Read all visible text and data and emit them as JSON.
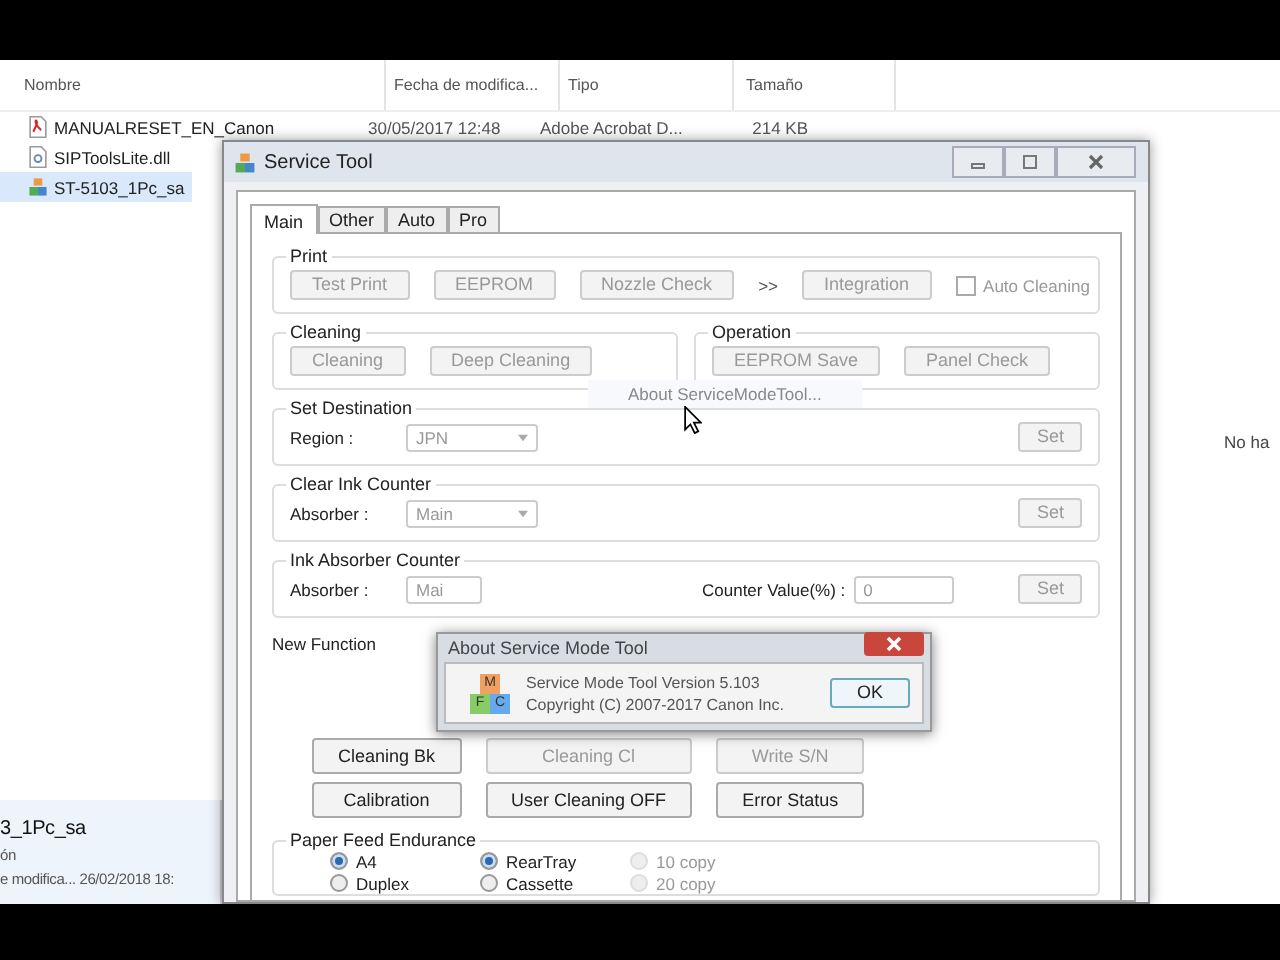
{
  "explorer": {
    "columns": [
      "Nombre",
      "Fecha de modifica...",
      "Tipo",
      "Tamaño"
    ],
    "rows": [
      {
        "name": "MANUALRESET_EN_Canon",
        "kind": "pdf",
        "date": "30/05/2017 12:48",
        "type": "Adobe Acrobat D...",
        "size": "214 KB",
        "selected": false
      },
      {
        "name": "SIPToolsLite.dll",
        "kind": "dll",
        "selected": false
      },
      {
        "name": "ST-5103_1Pc_sa",
        "kind": "app",
        "selected": true
      }
    ],
    "preview_text": "No ha",
    "details": {
      "name": "3_1Pc_sa",
      "line_2": "ón",
      "date_label": "e modifica...",
      "date": "26/02/2018 18:"
    }
  },
  "window": {
    "title": "Service Tool",
    "tabs": [
      {
        "label": "Main",
        "selected": true
      },
      {
        "label": "Other",
        "selected": false
      },
      {
        "label": "Auto",
        "selected": false
      },
      {
        "label": "Pro",
        "selected": false
      }
    ],
    "print": {
      "title": "Print",
      "buttons": [
        {
          "label": "Test Print",
          "disabled": true
        },
        {
          "label": "EEPROM",
          "disabled": true
        },
        {
          "label": "Nozzle Check",
          "disabled": true
        }
      ],
      "arrow": ">>",
      "integration": {
        "label": "Integration",
        "disabled": true
      },
      "auto_cleaning": {
        "label": "Auto Cleaning",
        "checked": false
      }
    },
    "cleaning": {
      "title": "Cleaning",
      "buttons": [
        {
          "label": "Cleaning",
          "disabled": true
        },
        {
          "label": "Deep Cleaning",
          "disabled": true
        }
      ]
    },
    "operation": {
      "title": "Operation",
      "buttons": [
        {
          "label": "EEPROM Save",
          "disabled": true
        },
        {
          "label": "Panel Check",
          "disabled": true
        }
      ]
    },
    "ghost_menu_item": "About ServiceModeTool...",
    "set_destination": {
      "title": "Set Destination",
      "label": "Region :",
      "value": "JPN",
      "button": "Set"
    },
    "clear_ink_counter": {
      "title": "Clear Ink Counter",
      "label": "Absorber :",
      "value": "Main",
      "button": "Set"
    },
    "ink_absorber_counter": {
      "title": "Ink Absorber Counter",
      "label": "Absorber :",
      "value": "Mai",
      "counter_label": "Counter Value(%) :",
      "counter_value": "0",
      "button": "Set"
    },
    "new_function": {
      "title": "New Function",
      "buttons": [
        {
          "label": "Cleaning Bk",
          "disabled": false
        },
        {
          "label": "Cleaning Cl",
          "disabled": true
        },
        {
          "label": "Write S/N",
          "disabled": true
        },
        {
          "label": "Calibration",
          "disabled": false
        },
        {
          "label": "User Cleaning OFF",
          "disabled": false
        },
        {
          "label": "Error Status",
          "disabled": false
        }
      ]
    },
    "paper_feed": {
      "title": "Paper Feed Endurance",
      "radios": [
        [
          {
            "label": "A4",
            "selected": true,
            "disabled": false
          },
          {
            "label": "RearTray",
            "selected": true,
            "disabled": false
          },
          {
            "label": "10 copy",
            "selected": false,
            "disabled": true
          }
        ],
        [
          {
            "label": "Duplex",
            "selected": false,
            "disabled": false
          },
          {
            "label": "Cassette",
            "selected": false,
            "disabled": false
          },
          {
            "label": "20 copy",
            "selected": false,
            "disabled": true
          }
        ]
      ]
    }
  },
  "about_dialog": {
    "title": "About Service Mode Tool",
    "icon_letters": [
      "M",
      "F",
      "C"
    ],
    "lines": [
      "Service Mode Tool  Version 5.103",
      "Copyright (C) 2007-2017 Canon Inc."
    ],
    "ok": "OK"
  }
}
